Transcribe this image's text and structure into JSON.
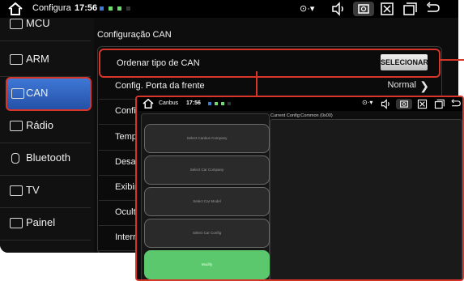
{
  "statusbar": {
    "title": "Configura",
    "time": "17:56"
  },
  "sidebar": {
    "items": [
      {
        "label": "MCU",
        "icon": "mcu-icon"
      },
      {
        "label": "ARM",
        "icon": "arm-icon"
      },
      {
        "label": "CAN",
        "icon": "can-icon",
        "selected": true
      },
      {
        "label": "Rádio",
        "icon": "radio-icon"
      },
      {
        "label": "Bluetooth",
        "icon": "bluetooth-icon"
      },
      {
        "label": "TV",
        "icon": "tv-icon"
      },
      {
        "label": "Painel",
        "icon": "panel-icon"
      }
    ]
  },
  "main": {
    "title": "Configuração CAN",
    "rows": [
      {
        "label": "Ordenar tipo de CAN",
        "button": "SELECIONAR"
      },
      {
        "label": "Config. Porta da frente",
        "value": "Normal"
      },
      {
        "label": "Confi"
      },
      {
        "label": "Temp"
      },
      {
        "label": "Desat"
      },
      {
        "label": "Exibir"
      },
      {
        "label": "Ocult"
      },
      {
        "label": "Interr"
      }
    ]
  },
  "overlay": {
    "title": "Canbus",
    "time": "17:56",
    "current_config": "Current Config:Common (0x00)",
    "buttons": [
      "Select Canbus Company",
      "Select Car Company",
      "Select Car Model",
      "Select Car Config",
      "Modify"
    ]
  },
  "colors": {
    "highlight": "#d8352a",
    "selected_blue": "#3f78d6",
    "modify_green": "#5cc86e"
  }
}
